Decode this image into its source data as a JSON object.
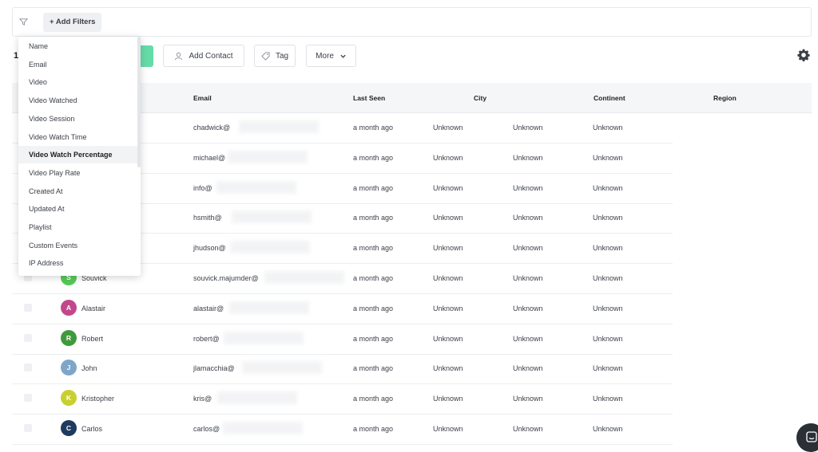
{
  "filter_bar": {
    "add_filters_label": "+ Add Filters"
  },
  "toolbar": {
    "count": "1",
    "add_contact_label": "Add Contact",
    "tag_label": "Tag",
    "more_label": "More"
  },
  "dropdown": {
    "items": [
      "Name",
      "Email",
      "Video",
      "Video Watched",
      "Video Session",
      "Video Watch Time",
      "Video Watch Percentage",
      "Video Play Rate",
      "Created At",
      "Updated At",
      "Playlist",
      "Custom Events",
      "IP Address"
    ],
    "active": "Video Watch Percentage"
  },
  "table": {
    "headers": {
      "email": "Email",
      "last_seen": "Last Seen",
      "city": "City",
      "continent": "Continent",
      "region": "Region"
    },
    "rows": [
      {
        "initial": "",
        "name": "",
        "email": "chadwick@",
        "last_seen": "a month ago",
        "c1": "Unknown",
        "c2": "Unknown",
        "c3": "Unknown",
        "color": "#ffffff"
      },
      {
        "initial": "",
        "name": "",
        "email": "michael@",
        "last_seen": "a month ago",
        "c1": "Unknown",
        "c2": "Unknown",
        "c3": "Unknown",
        "color": "#ffffff"
      },
      {
        "initial": "",
        "name": "",
        "email": "info@",
        "last_seen": "a month ago",
        "c1": "Unknown",
        "c2": "Unknown",
        "c3": "Unknown",
        "color": "#ffffff"
      },
      {
        "initial": "",
        "name": "",
        "email": "hsmith@",
        "last_seen": "a month ago",
        "c1": "Unknown",
        "c2": "Unknown",
        "c3": "Unknown",
        "color": "#ffffff"
      },
      {
        "initial": "",
        "name": "",
        "email": "jhudson@",
        "last_seen": "a month ago",
        "c1": "Unknown",
        "c2": "Unknown",
        "c3": "Unknown",
        "color": "#ffffff"
      },
      {
        "initial": "S",
        "name": "Souvick",
        "email": "souvick.majumder@",
        "last_seen": "a month ago",
        "c1": "Unknown",
        "c2": "Unknown",
        "c3": "Unknown",
        "color": "#55c957"
      },
      {
        "initial": "A",
        "name": "Alastair",
        "email": "alastair@",
        "last_seen": "a month ago",
        "c1": "Unknown",
        "c2": "Unknown",
        "c3": "Unknown",
        "color": "#c2478a"
      },
      {
        "initial": "R",
        "name": "Robert",
        "email": "robert@",
        "last_seen": "a month ago",
        "c1": "Unknown",
        "c2": "Unknown",
        "c3": "Unknown",
        "color": "#3f9a3c"
      },
      {
        "initial": "J",
        "name": "John",
        "email": "jlamacchia@",
        "last_seen": "a month ago",
        "c1": "Unknown",
        "c2": "Unknown",
        "c3": "Unknown",
        "color": "#7ea6c8"
      },
      {
        "initial": "K",
        "name": "Kristopher",
        "email": "kris@",
        "last_seen": "a month ago",
        "c1": "Unknown",
        "c2": "Unknown",
        "c3": "Unknown",
        "color": "#c8d030"
      },
      {
        "initial": "C",
        "name": "Carlos",
        "email": "carlos@",
        "last_seen": "a month ago",
        "c1": "Unknown",
        "c2": "Unknown",
        "c3": "Unknown",
        "color": "#1f3a5f"
      }
    ]
  },
  "colors": {
    "accent_green": "#66dba8",
    "chat": "#2b2f36"
  },
  "icons": {
    "filter": "filter-icon",
    "contact": "user-icon",
    "tag": "tag-icon",
    "more": "chevron-down-icon",
    "settings": "gear-icon",
    "chat": "chat-icon"
  }
}
